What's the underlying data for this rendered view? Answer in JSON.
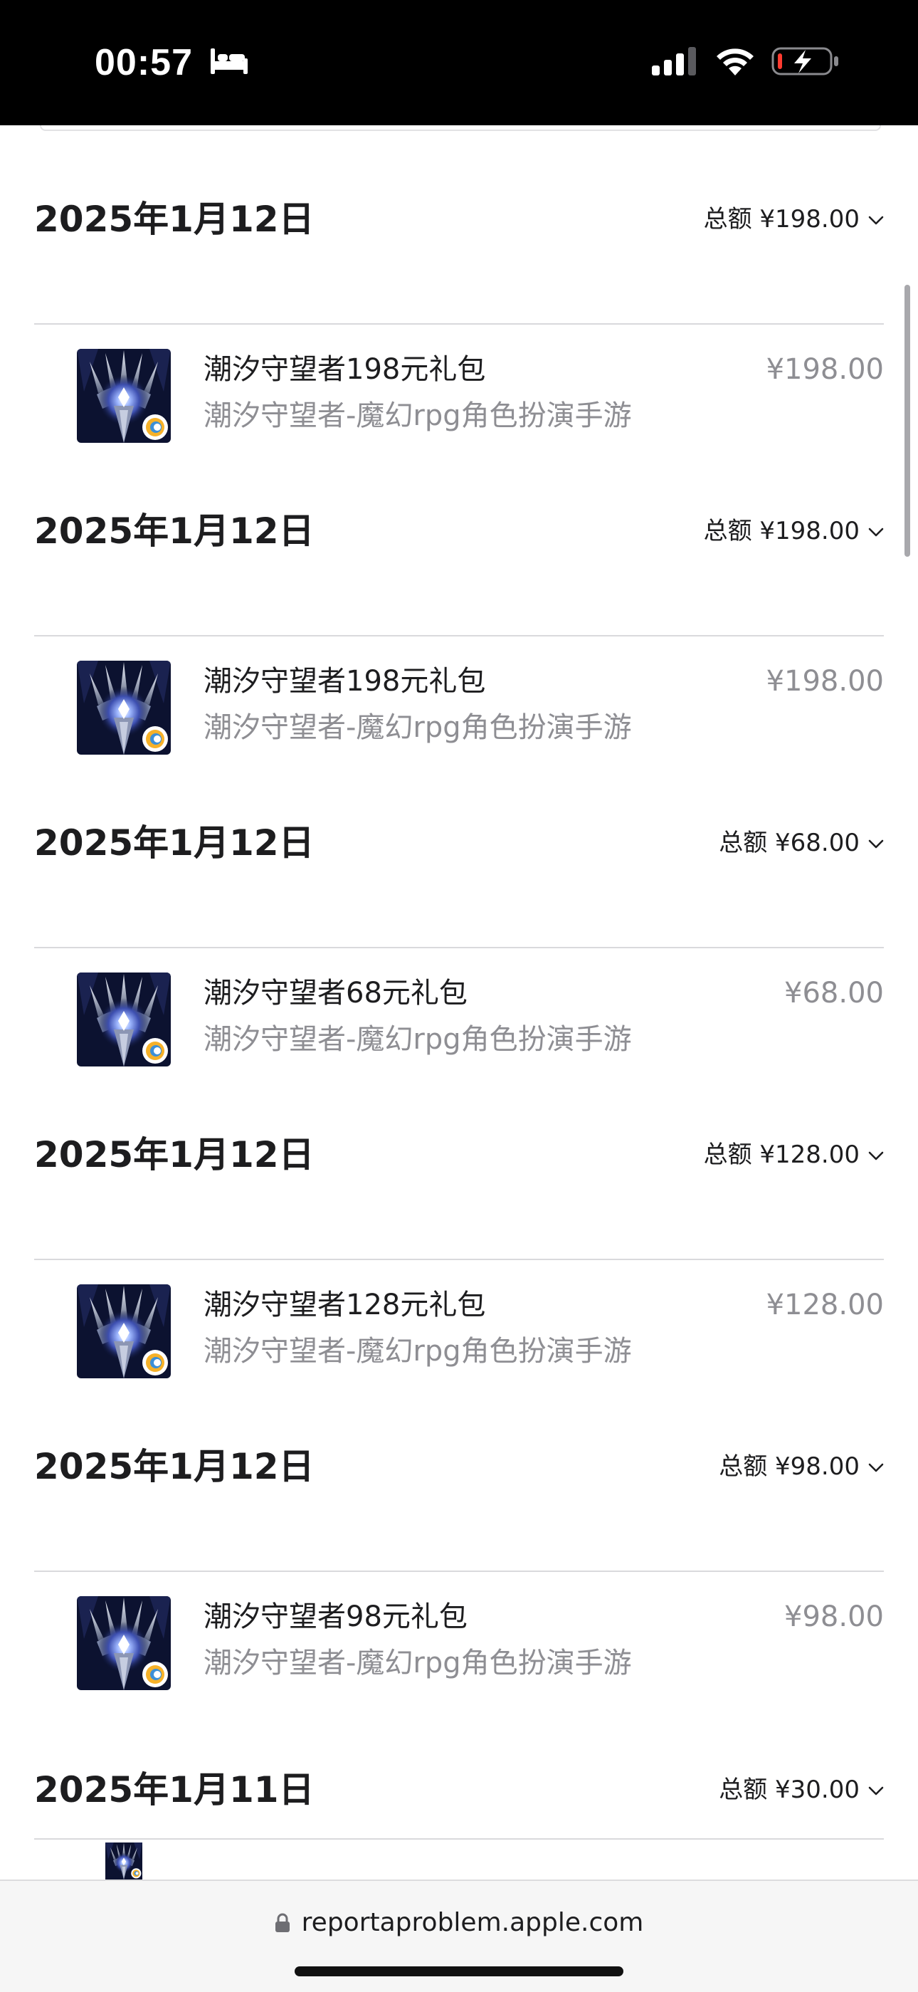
{
  "status_bar": {
    "time": "00:57",
    "icons": [
      "bed-icon",
      "cellular-signal-icon",
      "wifi-icon",
      "battery-charging-icon"
    ],
    "battery_state": "low, charging"
  },
  "purchases": [
    {
      "date": "2025年1月12日",
      "total": "总额 ¥198.00",
      "item": {
        "title": "潮汐守望者198元礼包",
        "subtitle": "潮汐守望者-魔幻rpg角色扮演手游",
        "price": "¥198.00"
      }
    },
    {
      "date": "2025年1月12日",
      "total": "总额 ¥198.00",
      "item": {
        "title": "潮汐守望者198元礼包",
        "subtitle": "潮汐守望者-魔幻rpg角色扮演手游",
        "price": "¥198.00"
      }
    },
    {
      "date": "2025年1月12日",
      "total": "总额 ¥68.00",
      "item": {
        "title": "潮汐守望者68元礼包",
        "subtitle": "潮汐守望者-魔幻rpg角色扮演手游",
        "price": "¥68.00"
      }
    },
    {
      "date": "2025年1月12日",
      "total": "总额 ¥128.00",
      "item": {
        "title": "潮汐守望者128元礼包",
        "subtitle": "潮汐守望者-魔幻rpg角色扮演手游",
        "price": "¥128.00"
      }
    },
    {
      "date": "2025年1月12日",
      "total": "总额 ¥98.00",
      "item": {
        "title": "潮汐守望者98元礼包",
        "subtitle": "潮汐守望者-魔幻rpg角色扮演手游",
        "price": "¥98.00"
      }
    }
  ],
  "partial_purchase": {
    "date": "2025年1月11日",
    "total": "总额 ¥30.00"
  },
  "url_bar": {
    "url": "reportaproblem.apple.com",
    "icon": "lock-icon"
  },
  "colors": {
    "status_bar_bg": "#000000",
    "primary_text": "#1d1d1f",
    "secondary_text": "#8e8e93",
    "divider": "#d9d9dc",
    "battery_low": "#ff3b30"
  }
}
